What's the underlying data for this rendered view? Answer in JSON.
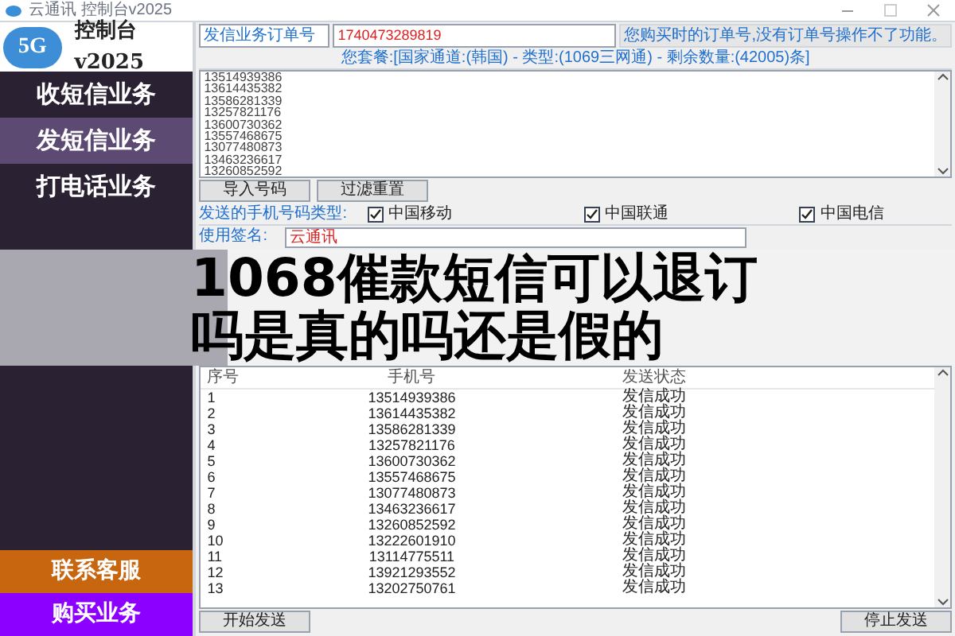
{
  "window": {
    "title": "云通讯 控制台v2025"
  },
  "sidebar": {
    "logo_text": "5G",
    "brand": "控制台v2025",
    "items": [
      {
        "label": "收短信业务",
        "selected": false
      },
      {
        "label": "发短信业务",
        "selected": true
      },
      {
        "label": "打电话业务",
        "selected": false
      }
    ],
    "bottom_items": [
      {
        "label": "联系客服",
        "color": "#c8650f"
      },
      {
        "label": "购买业务",
        "color": "#8b00ff"
      }
    ]
  },
  "order": {
    "label": "发信业务订单号",
    "value": "1740473289819",
    "hint": "您购买时的订单号,没有订单号操作不了功能。"
  },
  "plan": "您套餐:[国家通道:(韩国) - 类型:(1069三网通) - 剩余数量:(42005)条]",
  "numbers": [
    "13514939386",
    "13614435382",
    "13586281339",
    "13257821176",
    "13600730362",
    "13557468675",
    "13077480873",
    "13463236617",
    "13260852592"
  ],
  "number_buttons": [
    "导入号码",
    "过滤重置"
  ],
  "carrier_label": "发送的手机号码类型:",
  "carriers": [
    {
      "label": "中国移动",
      "checked": true
    },
    {
      "label": "中国联通",
      "checked": true
    },
    {
      "label": "中国电信",
      "checked": true
    }
  ],
  "signature": {
    "label": "使用签名:",
    "value": "云通讯"
  },
  "table": {
    "columns": [
      "序号",
      "手机号",
      "发送状态"
    ],
    "rows": [
      {
        "no": "1",
        "phone": "13514939386",
        "status": "发信成功"
      },
      {
        "no": "2",
        "phone": "13614435382",
        "status": "发信成功"
      },
      {
        "no": "3",
        "phone": "13586281339",
        "status": "发信成功"
      },
      {
        "no": "4",
        "phone": "13257821176",
        "status": "发信成功"
      },
      {
        "no": "5",
        "phone": "13600730362",
        "status": "发信成功"
      },
      {
        "no": "6",
        "phone": "13557468675",
        "status": "发信成功"
      },
      {
        "no": "7",
        "phone": "13077480873",
        "status": "发信成功"
      },
      {
        "no": "8",
        "phone": "13463236617",
        "status": "发信成功"
      },
      {
        "no": "9",
        "phone": "13260852592",
        "status": "发信成功"
      },
      {
        "no": "10",
        "phone": "13222601910",
        "status": "发信成功"
      },
      {
        "no": "11",
        "phone": "13114775511",
        "status": "发信成功"
      },
      {
        "no": "12",
        "phone": "13921293552",
        "status": "发信成功"
      },
      {
        "no": "13",
        "phone": "13202750761",
        "status": "发信成功"
      }
    ]
  },
  "send_buttons": [
    "开始发送",
    "停止发送"
  ],
  "headline": "1068催款短信可以退订吗是真的吗还是假的"
}
